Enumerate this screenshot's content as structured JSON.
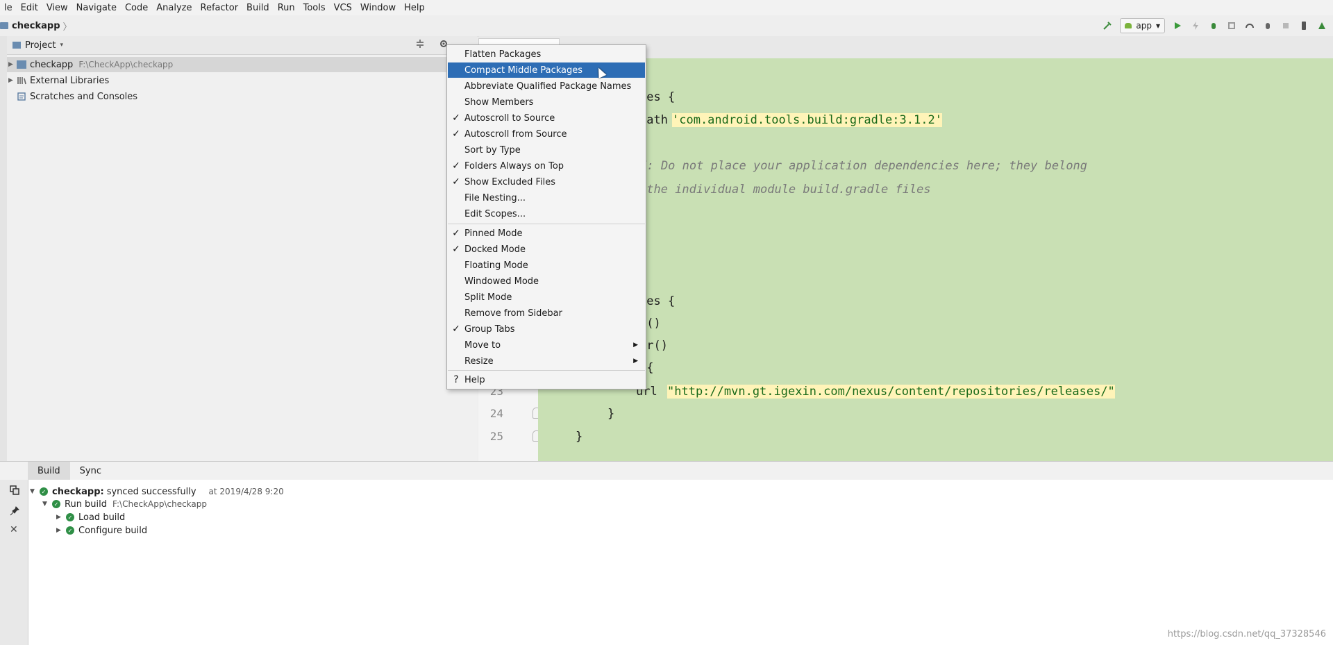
{
  "menubar": [
    "le",
    "Edit",
    "View",
    "Navigate",
    "Code",
    "Analyze",
    "Refactor",
    "Build",
    "Run",
    "Tools",
    "VCS",
    "Window",
    "Help"
  ],
  "breadcrumb": {
    "project": "checkapp",
    "sep": "〉"
  },
  "toolbar": {
    "run_config": "app",
    "run_config_drop": "▾"
  },
  "project_panel": {
    "title": "Project",
    "dropdown": "▾",
    "items": [
      {
        "label": "checkapp",
        "path": "F:\\CheckApp\\checkapp"
      },
      {
        "label": "External Libraries",
        "path": ""
      },
      {
        "label": "Scratches and Consoles",
        "path": ""
      }
    ]
  },
  "popup_menu": {
    "items": [
      {
        "label": "Flatten Packages",
        "checked": false
      },
      {
        "label": "Compact Middle Packages",
        "checked": false,
        "highlighted": true
      },
      {
        "label": "Abbreviate Qualified Package Names",
        "checked": false
      },
      {
        "label": "Show Members",
        "checked": false
      },
      {
        "label": "Autoscroll to Source",
        "checked": true
      },
      {
        "label": "Autoscroll from Source",
        "checked": true
      },
      {
        "label": "Sort by Type",
        "checked": false
      },
      {
        "label": "Folders Always on Top",
        "checked": true
      },
      {
        "label": "Show Excluded Files",
        "checked": true
      },
      {
        "label": "File Nesting...",
        "checked": false
      },
      {
        "label": "Edit Scopes...",
        "checked": false
      },
      {
        "label": "Pinned Mode",
        "checked": true
      },
      {
        "label": "Docked Mode",
        "checked": true
      },
      {
        "label": "Floating Mode",
        "checked": false
      },
      {
        "label": "Windowed Mode",
        "checked": false
      },
      {
        "label": "Split Mode",
        "checked": false
      },
      {
        "label": "Remove from Sidebar",
        "checked": false
      },
      {
        "label": "Group Tabs",
        "checked": true
      },
      {
        "label": "Move to",
        "checked": false,
        "submenu": true
      },
      {
        "label": "Resize",
        "checked": false,
        "submenu": true
      },
      {
        "label": "Help",
        "checked": false,
        "icon": "?"
      }
    ],
    "check_glyph": "✓",
    "submenu_glyph": "▶"
  },
  "editor": {
    "lines": [
      {
        "text": "ies {",
        "kind": "code"
      },
      {
        "text": "path ",
        "kind": "code"
      },
      {
        "text": "'com.android.tools.build:gradle:3.1.2'",
        "kind": "str"
      },
      {
        "text": "TE: Do not place your application dependencies here; they belong",
        "kind": "cmt"
      },
      {
        "text": " the individual module build.gradle files",
        "kind": "cmt"
      },
      {
        "text": "ies {",
        "kind": "code"
      },
      {
        "text": "e()",
        "kind": "code"
      },
      {
        "text": "er()",
        "kind": "code"
      },
      {
        "text": " {",
        "kind": "code"
      },
      {
        "text": "url ",
        "kind": "code"
      },
      {
        "text": "\"http://mvn.gt.igexin.com/nexus/content/repositories/releases/\"",
        "kind": "str"
      },
      {
        "text": "}",
        "kind": "code"
      },
      {
        "text": "}",
        "kind": "code"
      }
    ],
    "line_numbers": [
      "23",
      "24",
      "25"
    ]
  },
  "build_panel": {
    "tabs": [
      "Build",
      "Sync"
    ],
    "rows": [
      {
        "label": "checkapp:",
        "detail": "synced successfully",
        "time": "at 2019/4/28 9:20"
      },
      {
        "label": "Run build",
        "detail": "F:\\CheckApp\\checkapp"
      },
      {
        "label": "Load build",
        "detail": ""
      },
      {
        "label": "Configure build",
        "detail": ""
      }
    ]
  },
  "watermark": "https://blog.csdn.net/qq_37328546",
  "colors": {
    "accent": "#2d6db5",
    "editor_bg": "#c9e0b4",
    "ok_green": "#2f8f46"
  }
}
